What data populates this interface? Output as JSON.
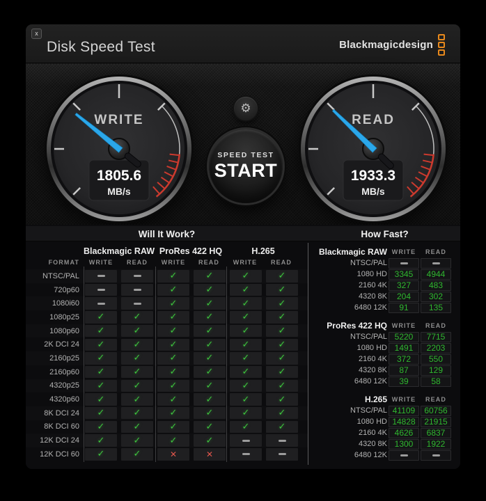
{
  "window": {
    "title": "Disk Speed Test",
    "close_label": "x"
  },
  "logo": {
    "text": "Blackmagicdesign"
  },
  "gauges": {
    "write": {
      "label": "WRITE",
      "value": "1805.6",
      "unit": "MB/s",
      "needle_deg": -51
    },
    "read": {
      "label": "READ",
      "value": "1933.3",
      "unit": "MB/s",
      "needle_deg": -46
    }
  },
  "controls": {
    "start_line1": "SPEED TEST",
    "start_line2": "START"
  },
  "will_it_work": {
    "title": "Will It Work?",
    "format_header": "FORMAT",
    "col_headers": [
      "WRITE",
      "READ"
    ],
    "groups": [
      {
        "name": "Blackmagic RAW"
      },
      {
        "name": "ProRes 422 HQ"
      },
      {
        "name": "H.265"
      }
    ],
    "rows": [
      {
        "format": "NTSC/PAL",
        "cells": [
          "dash",
          "dash",
          "check",
          "check",
          "check",
          "check"
        ]
      },
      {
        "format": "720p60",
        "cells": [
          "dash",
          "dash",
          "check",
          "check",
          "check",
          "check"
        ]
      },
      {
        "format": "1080i60",
        "cells": [
          "dash",
          "dash",
          "check",
          "check",
          "check",
          "check"
        ]
      },
      {
        "format": "1080p25",
        "cells": [
          "check",
          "check",
          "check",
          "check",
          "check",
          "check"
        ]
      },
      {
        "format": "1080p60",
        "cells": [
          "check",
          "check",
          "check",
          "check",
          "check",
          "check"
        ]
      },
      {
        "format": "2K DCI 24",
        "cells": [
          "check",
          "check",
          "check",
          "check",
          "check",
          "check"
        ]
      },
      {
        "format": "2160p25",
        "cells": [
          "check",
          "check",
          "check",
          "check",
          "check",
          "check"
        ]
      },
      {
        "format": "2160p60",
        "cells": [
          "check",
          "check",
          "check",
          "check",
          "check",
          "check"
        ]
      },
      {
        "format": "4320p25",
        "cells": [
          "check",
          "check",
          "check",
          "check",
          "check",
          "check"
        ]
      },
      {
        "format": "4320p60",
        "cells": [
          "check",
          "check",
          "check",
          "check",
          "check",
          "check"
        ]
      },
      {
        "format": "8K DCI 24",
        "cells": [
          "check",
          "check",
          "check",
          "check",
          "check",
          "check"
        ]
      },
      {
        "format": "8K DCI 60",
        "cells": [
          "check",
          "check",
          "check",
          "check",
          "check",
          "check"
        ]
      },
      {
        "format": "12K DCI 24",
        "cells": [
          "check",
          "check",
          "check",
          "check",
          "dash",
          "dash"
        ]
      },
      {
        "format": "12K DCI 60",
        "cells": [
          "check",
          "check",
          "cross",
          "cross",
          "dash",
          "dash"
        ]
      }
    ]
  },
  "how_fast": {
    "title": "How Fast?",
    "col_headers": [
      "WRITE",
      "READ"
    ],
    "sections": [
      {
        "name": "Blackmagic RAW",
        "rows": [
          {
            "format": "NTSC/PAL",
            "write": "-",
            "read": "-"
          },
          {
            "format": "1080 HD",
            "write": "3345",
            "read": "4944"
          },
          {
            "format": "2160 4K",
            "write": "327",
            "read": "483"
          },
          {
            "format": "4320 8K",
            "write": "204",
            "read": "302"
          },
          {
            "format": "6480 12K",
            "write": "91",
            "read": "135"
          }
        ]
      },
      {
        "name": "ProRes 422 HQ",
        "rows": [
          {
            "format": "NTSC/PAL",
            "write": "5220",
            "read": "7715"
          },
          {
            "format": "1080 HD",
            "write": "1491",
            "read": "2203"
          },
          {
            "format": "2160 4K",
            "write": "372",
            "read": "550"
          },
          {
            "format": "4320 8K",
            "write": "87",
            "read": "129"
          },
          {
            "format": "6480 12K",
            "write": "39",
            "read": "58"
          }
        ]
      },
      {
        "name": "H.265",
        "rows": [
          {
            "format": "NTSC/PAL",
            "write": "41109",
            "read": "60756"
          },
          {
            "format": "1080 HD",
            "write": "14828",
            "read": "21915"
          },
          {
            "format": "2160 4K",
            "write": "4626",
            "read": "6837"
          },
          {
            "format": "4320 8K",
            "write": "1300",
            "read": "1922"
          },
          {
            "format": "6480 12K",
            "write": "-",
            "read": "-"
          }
        ]
      }
    ]
  },
  "colors": {
    "green": "#2fb72f",
    "check_green": "#3ec43e",
    "red": "#e0564c",
    "dash_gray": "#9c9c9c",
    "logo_orange": "#e8891c",
    "needle_blue": "#2ba7ea"
  }
}
